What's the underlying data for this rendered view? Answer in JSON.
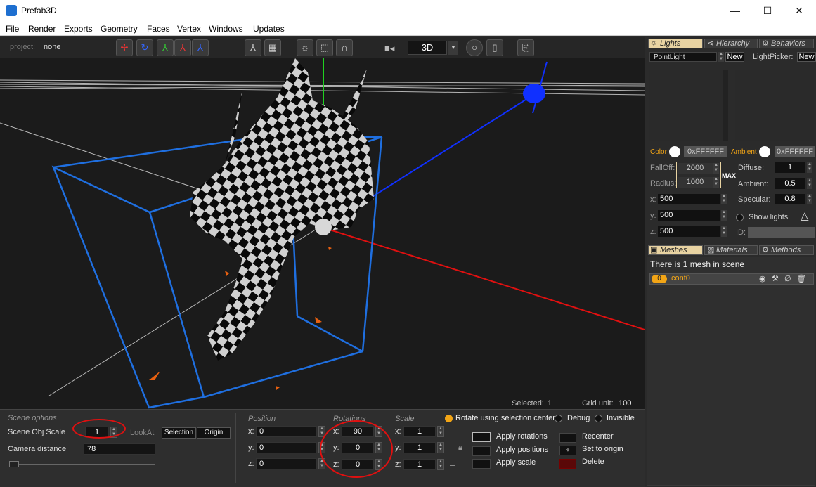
{
  "window": {
    "title": "Prefab3D",
    "minimize": "—",
    "maximize": "☐",
    "close": "✕"
  },
  "menu": [
    "File",
    "Render",
    "Exports",
    "Geometry",
    "Faces",
    "Vertex",
    "Windows",
    "Updates"
  ],
  "toolbar": {
    "project_label": "project:",
    "project_value": "none",
    "view_mode": "3D"
  },
  "viewport": {
    "selected_label": "Selected:",
    "selected_value": "1",
    "grid_label": "Grid unit:",
    "grid_value": "100"
  },
  "scene_options": {
    "title": "Scene options",
    "scale_label": "Scene Obj Scale",
    "scale_value": "1",
    "lookat_label": "LookAt",
    "selection_btn": "Selection",
    "origin_btn": "Origin",
    "camera_label": "Camera distance",
    "camera_value": "78"
  },
  "position": {
    "title": "Position",
    "x": "0",
    "y": "0",
    "z": "0"
  },
  "rotations": {
    "title": "Rotations",
    "x": "90",
    "y": "0",
    "z": "0"
  },
  "scale": {
    "title": "Scale",
    "x": "1",
    "y": "1",
    "z": "1"
  },
  "options": {
    "rotate_center": "Rotate using selection center",
    "debug": "Debug",
    "invisible": "Invisible",
    "apply_rotations": "Apply rotations",
    "apply_positions": "Apply positions",
    "apply_scale": "Apply scale",
    "recenter": "Recenter",
    "set_to_origin": "Set to origin",
    "delete": "Delete"
  },
  "right_tabs": {
    "lights": "Lights",
    "hierarchy": "Hierarchy",
    "behaviors": "Behaviors"
  },
  "lights": {
    "type": "PointLight",
    "new_btn": "New",
    "picker_label": "LightPicker:",
    "picker_new": "New",
    "color_label": "Color",
    "color_value": "0xFFFFFF",
    "ambient_label": "Ambient",
    "ambient_value": "0xFFFFFF",
    "falloff_label": "FallOff:",
    "falloff_value": "2000",
    "radius_label": "Radius:",
    "radius_value": "1000",
    "max_label": "MAX",
    "diffuse_label": "Diffuse:",
    "diffuse_value": "1",
    "ambient2_label": "Ambient:",
    "ambient2_value": "0.5",
    "specular_label": "Specular:",
    "specular_value": "0.8",
    "x_label": "x:",
    "x_value": "500",
    "y_label": "y:",
    "y_value": "500",
    "z_label": "z:",
    "z_value": "500",
    "show_lights": "Show lights",
    "id_label": "ID:"
  },
  "mesh_tabs": {
    "meshes": "Meshes",
    "materials": "Materials",
    "methods": "Methods"
  },
  "meshes": {
    "info": "There is 1 mesh in scene",
    "item_index": "0",
    "item_name": "cont0"
  },
  "colors": {
    "accent": "#f2a516",
    "x_axis": "#e01010",
    "y_axis": "#20d020",
    "z_axis": "#1030ff",
    "bbox": "#1f6fe0"
  }
}
